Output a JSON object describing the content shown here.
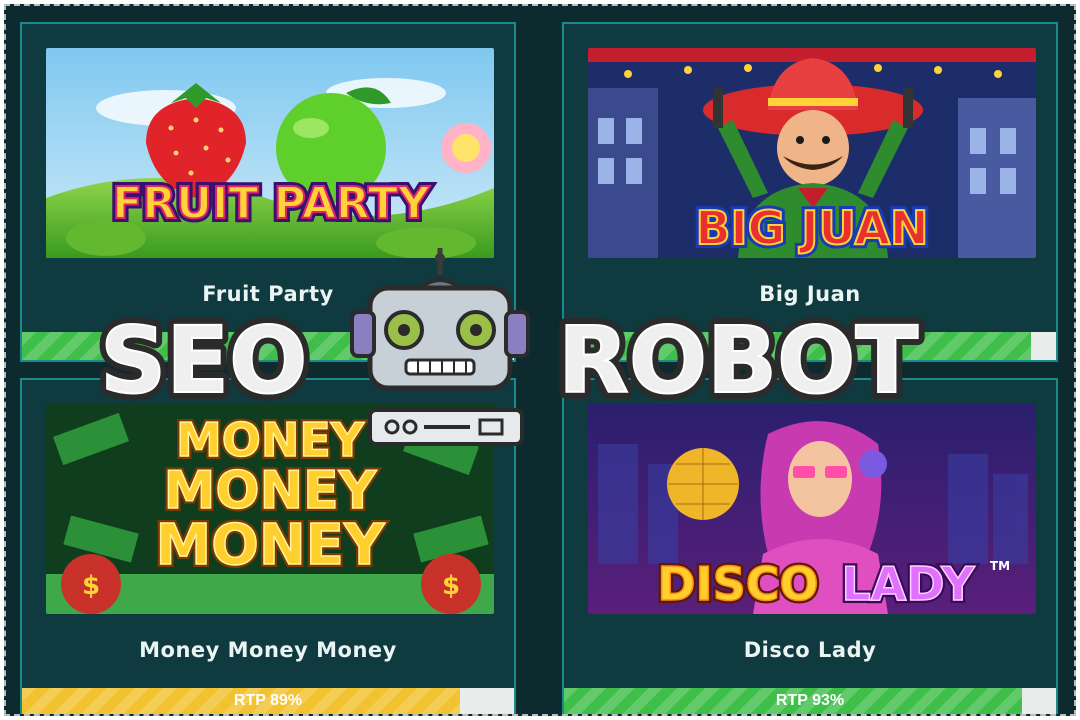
{
  "games": [
    {
      "title": "Fruit Party",
      "art_text": "FRUIT PARTY",
      "rtp_label": "",
      "rtp_fraction": 0.95,
      "bar_color": "#3fbf4a"
    },
    {
      "title": "Big Juan",
      "art_text": "BIG JUAN",
      "rtp_label": "",
      "rtp_fraction": 0.95,
      "bar_color": "#3fbf4a"
    },
    {
      "title": "Money Money Money",
      "art_text_lines": [
        "MONEY",
        "MONEY",
        "MONEY"
      ],
      "rtp_label": "RTP 89%",
      "rtp_fraction": 0.89,
      "bar_color": "#f2c230"
    },
    {
      "title": "Disco Lady",
      "art_text_lines": [
        "DISCO",
        "LADY"
      ],
      "tm": "TM",
      "rtp_label": "RTP 93%",
      "rtp_fraction": 0.93,
      "bar_color": "#3fbf4a"
    }
  ],
  "watermark": {
    "left_word": "SEO",
    "right_word": "ROBOT",
    "icon": "robot-icon"
  }
}
